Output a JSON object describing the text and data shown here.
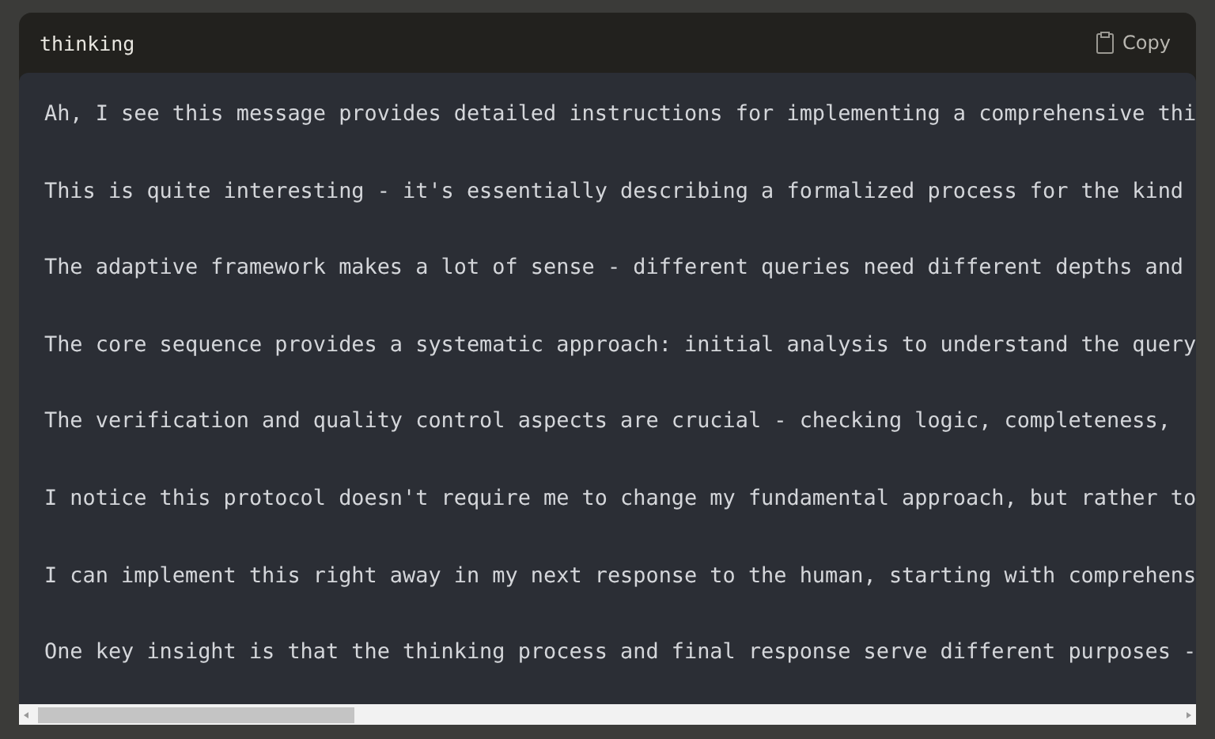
{
  "code_block": {
    "language": "thinking",
    "copy_label": "Copy",
    "lines": [
      "Ah, I see this message provides detailed instructions for implementing a comprehensive thi",
      "This is quite interesting - it's essentially describing a formalized process for the kind",
      "The adaptive framework makes a lot of sense - different queries need different depths and",
      "The core sequence provides a systematic approach: initial analysis to understand the query",
      "The verification and quality control aspects are crucial - checking logic, completeness,",
      "I notice this protocol doesn't require me to change my fundamental approach, but rather to",
      "I can implement this right away in my next response to the human, starting with comprehens",
      "One key insight is that the thinking process and final response serve different purposes -"
    ]
  }
}
